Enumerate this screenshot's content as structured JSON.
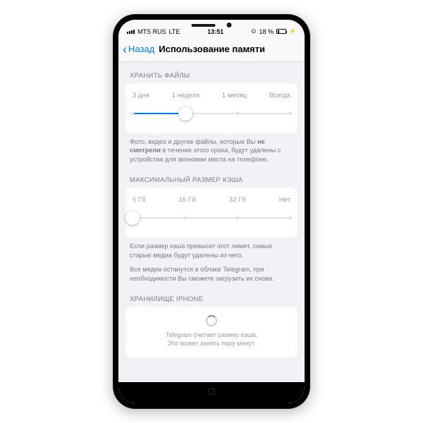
{
  "statusbar": {
    "carrier": "MTS RUS",
    "network": "LTE",
    "time": "13:51",
    "battery_pct": "18 %"
  },
  "nav": {
    "back": "Назад",
    "title": "Использование памяти"
  },
  "storage": {
    "header": "ХРАНИТЬ ФАЙЛЫ",
    "options": [
      "3 дня",
      "1 неделя",
      "1 месяц",
      "Всегда"
    ],
    "selected_index": 1,
    "footer_pre": "Фото, видео и другие файлы, которые Вы ",
    "footer_bold": "не смотрели",
    "footer_post": " в течение этого срока, будут удалены с устройства для экономии места на телефоне."
  },
  "cache": {
    "header": "МАКСИМАЛЬНЫЙ РАЗМЕР КЭША",
    "options": [
      "5 Гб",
      "16 Гб",
      "32 Гб",
      "Нет"
    ],
    "selected_index": 0,
    "footer1": "Если размер кэша превысит этот лимит, самые старые медиа будут удалены из него.",
    "footer2": "Все медиа останутся в облаке Telegram, при необходимости Вы сможете загрузить их снова."
  },
  "iphone_storage": {
    "header": "ХРАНИЛИЩЕ IPHONE",
    "loading1": "Telegram считает размер кэша.",
    "loading2": "Это может занять пару минут."
  }
}
